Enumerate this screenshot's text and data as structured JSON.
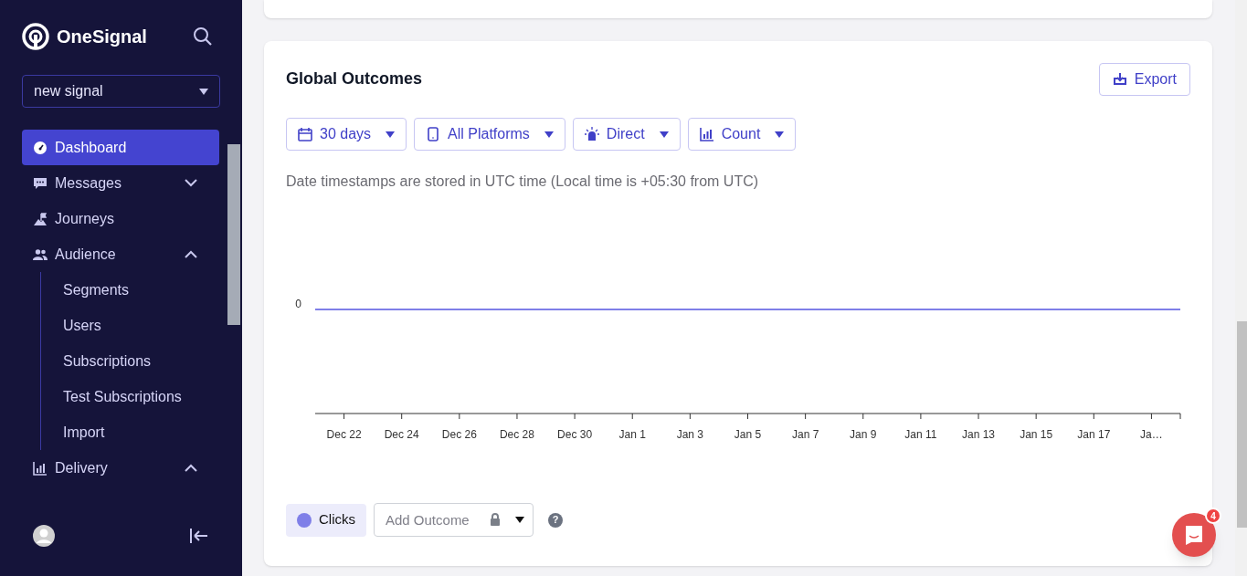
{
  "sidebar": {
    "brand": "OneSignal",
    "app_selector": {
      "value": "new signal"
    },
    "items": [
      {
        "label": "Dashboard",
        "selected": true
      },
      {
        "label": "Messages",
        "selected": false,
        "expanded": false
      },
      {
        "label": "Journeys",
        "selected": false
      },
      {
        "label": "Audience",
        "selected": false,
        "expanded": true,
        "children": [
          {
            "label": "Segments",
            "selected": false
          },
          {
            "label": "Users",
            "selected": false
          },
          {
            "label": "Subscriptions",
            "selected": false
          },
          {
            "label": "Test Subscriptions",
            "selected": false
          },
          {
            "label": "Import",
            "selected": false
          }
        ]
      },
      {
        "label": "Delivery",
        "selected": false,
        "expanded": true
      }
    ]
  },
  "card": {
    "title": "Global Outcomes",
    "export_button": "Export",
    "filters": [
      {
        "label": "30 days"
      },
      {
        "label": "All Platforms"
      },
      {
        "label": "Direct"
      },
      {
        "label": "Count"
      }
    ],
    "note": "Date timestamps are stored in UTC time (Local time is +05:30 from UTC)",
    "chart": {
      "y_label": "0",
      "x_labels": [
        "Dec 22",
        "Dec 24",
        "Dec 26",
        "Dec 28",
        "Dec 30",
        "Jan 1",
        "Jan 3",
        "Jan 5",
        "Jan 7",
        "Jan 9",
        "Jan 11",
        "Jan 13",
        "Jan 15",
        "Jan 17",
        "Ja…"
      ]
    },
    "legend": [
      {
        "label": "Clicks",
        "color": "#7f7fe8"
      }
    ],
    "add_outcome": {
      "placeholder": "Add Outcome"
    },
    "help": "?"
  },
  "chat_launcher": {
    "badge": "4"
  }
}
